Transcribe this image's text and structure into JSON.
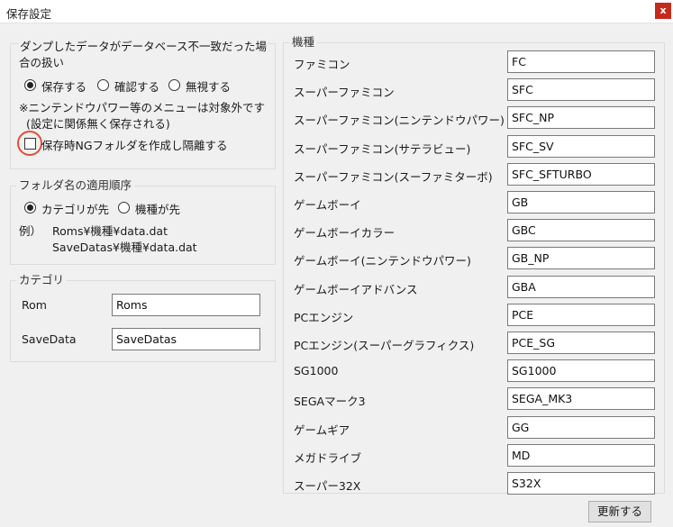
{
  "window": {
    "title": "保存設定",
    "close_label": "x"
  },
  "mismatch": {
    "title_line1": "ダンプしたデータがデータベース不一致だった場",
    "title_line2": "合の扱い",
    "options": [
      "保存する",
      "確認する",
      "無視する"
    ],
    "selected": "保存する",
    "note_line1": "※ニンテンドウパワー等のメニューは対象外です",
    "note_line2": "(設定に関係無く保存される)",
    "isolate_ng_label": "保存時NGフォルダを作成し隔離する",
    "isolate_ng_checked": false
  },
  "folder_order": {
    "title": "フォルダ名の適用順序",
    "options": [
      "カテゴリが先",
      "機種が先"
    ],
    "selected": "カテゴリが先",
    "example_label": "例）",
    "example_line1": "Roms¥機種¥data.dat",
    "example_line2": "SaveDatas¥機種¥data.dat"
  },
  "category": {
    "title": "カテゴリ",
    "fields": [
      {
        "label": "Rom",
        "value": "Roms"
      },
      {
        "label": "SaveData",
        "value": "SaveDatas"
      }
    ]
  },
  "machines": {
    "title": "機種",
    "items": [
      {
        "label": "ファミコン",
        "value": "FC"
      },
      {
        "label": "スーパーファミコン",
        "value": "SFC"
      },
      {
        "label": "スーパーファミコン(ニンテンドウパワー)",
        "value": "SFC_NP"
      },
      {
        "label": "スーパーファミコン(サテラビュー)",
        "value": "SFC_SV"
      },
      {
        "label": "スーパーファミコン(スーファミターボ)",
        "value": "SFC_SFTURBO"
      },
      {
        "label": "ゲームボーイ",
        "value": "GB"
      },
      {
        "label": "ゲームボーイカラー",
        "value": "GBC"
      },
      {
        "label": "ゲームボーイ(ニンテンドウパワー)",
        "value": "GB_NP"
      },
      {
        "label": "ゲームボーイアドバンス",
        "value": "GBA"
      },
      {
        "label": "PCエンジン",
        "value": "PCE"
      },
      {
        "label": "PCエンジン(スーパーグラフィクス)",
        "value": "PCE_SG"
      },
      {
        "label": "SG1000",
        "value": "SG1000"
      },
      {
        "label": "SEGAマーク3",
        "value": "SEGA_MK3"
      },
      {
        "label": "ゲームギア",
        "value": "GG"
      },
      {
        "label": "メガドライブ",
        "value": "MD"
      },
      {
        "label": "スーパー32X",
        "value": "S32X"
      }
    ]
  },
  "update_button": "更新する"
}
